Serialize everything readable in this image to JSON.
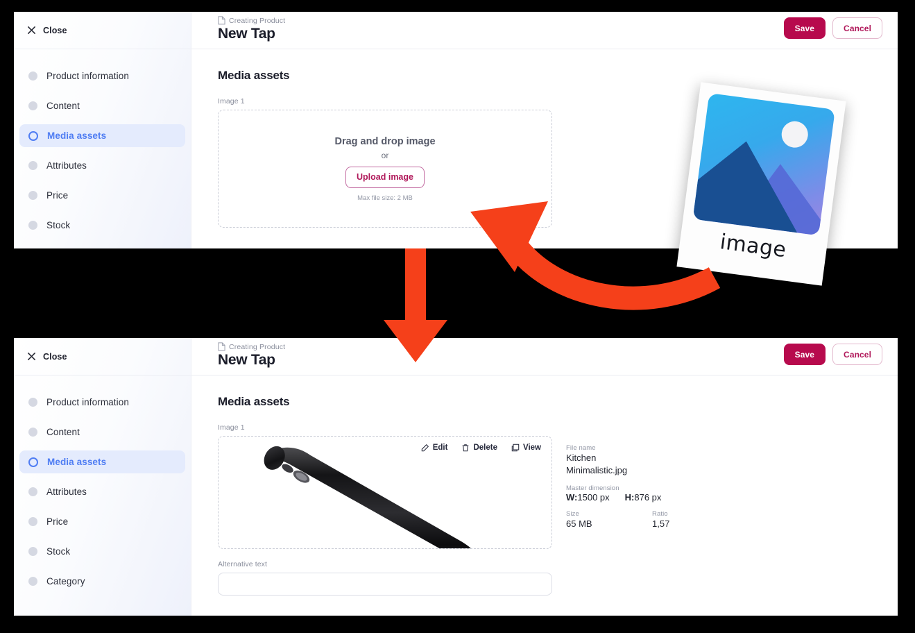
{
  "app": {
    "close_label": "Close",
    "breadcrumb": "Creating Product",
    "page_title": "New Tap",
    "save_label": "Save",
    "cancel_label": "Cancel",
    "accent_save": "#b70a4d",
    "accent_cancel_text": "#b0185a",
    "accent_active_nav": "#4f7df3",
    "annotation_arrow_color": "#f5401a"
  },
  "sidebar": {
    "items": [
      {
        "label": "Product information",
        "active": false
      },
      {
        "label": "Content",
        "active": false
      },
      {
        "label": "Media assets",
        "active": true
      },
      {
        "label": "Attributes",
        "active": false
      },
      {
        "label": "Price",
        "active": false
      },
      {
        "label": "Stock",
        "active": false
      },
      {
        "label": "Category",
        "active": false
      }
    ]
  },
  "media_section": {
    "title": "Media assets",
    "image_label": "Image 1"
  },
  "dropzone": {
    "title": "Drag and drop image",
    "or": "or",
    "button": "Upload image",
    "note": "Max file size: 2 MB"
  },
  "image_tools": [
    {
      "label": "Edit",
      "icon": "edit-icon"
    },
    {
      "label": "Delete",
      "icon": "trash-icon"
    },
    {
      "label": "View",
      "icon": "expand-icon"
    }
  ],
  "file_meta": {
    "file_name_label": "File name",
    "file_name_line1": "Kitchen",
    "file_name_line2": "Minimalistic.jpg",
    "dimension_label": "Master dimension",
    "width_key": "W:",
    "width_value": "1500 px",
    "height_key": "H:",
    "height_value": "876 px",
    "size_label": "Size",
    "size_value": "65 MB",
    "ratio_label": "Ratio",
    "ratio_value": "1,57"
  },
  "alt_text": {
    "label": "Alternative text",
    "value": "",
    "placeholder": ""
  },
  "annotation": {
    "polaroid_caption": "image"
  }
}
